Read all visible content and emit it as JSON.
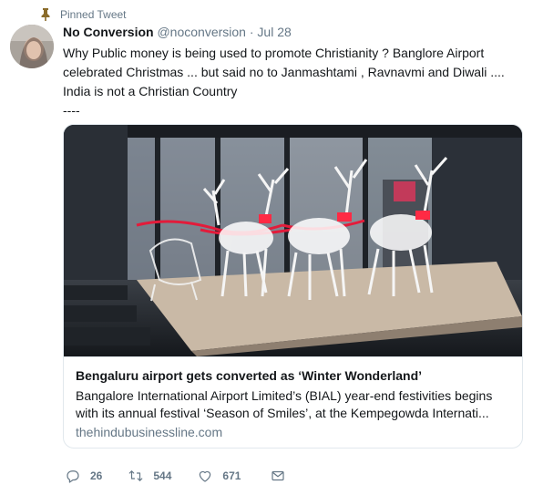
{
  "pinned": {
    "label": "Pinned Tweet",
    "icon": "pin-icon",
    "icon_color": "#8a6b2a"
  },
  "author": {
    "name": "No Conversion",
    "handle": "@noconversion",
    "separator": "·",
    "date": "Jul 28"
  },
  "tweet": {
    "lines": [
      "Why Public money is being used to promote Christianity ? Banglore Airport",
      "celebrated Christmas ... but said no to Janmashtami , Ravnavmi and Diwali ....",
      "India is not a Christian Country",
      "----"
    ]
  },
  "card": {
    "title": "Bengaluru airport gets converted as ‘Winter Wonderland’",
    "description_lines": [
      "Bangalore International Airport Limited’s (BIAL) year-end festivities begins",
      "with its annual festival ‘Season of Smiles’, at the Kempegowda Internati..."
    ],
    "domain": "thehindubusinessline.com"
  },
  "actions": {
    "reply": {
      "icon": "reply-icon",
      "count": "26"
    },
    "retweet": {
      "icon": "retweet-icon",
      "count": "544"
    },
    "like": {
      "icon": "heart-icon",
      "count": "671"
    },
    "message": {
      "icon": "envelope-icon"
    }
  },
  "colors": {
    "text": "#14171a",
    "secondary": "#657786",
    "border": "#e1e8ed"
  }
}
